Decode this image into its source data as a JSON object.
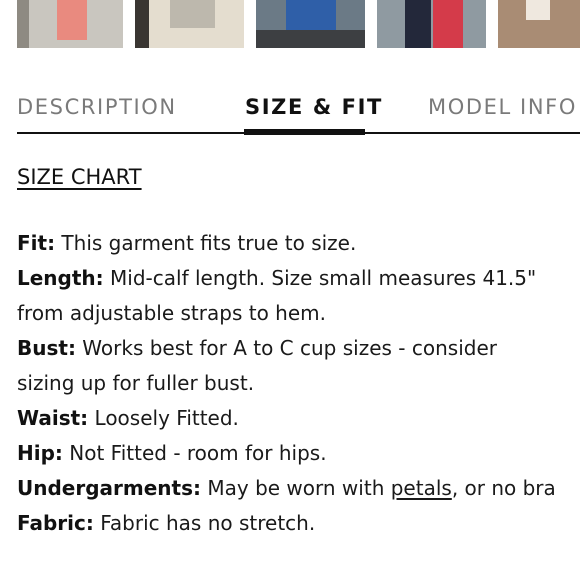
{
  "thumbnails": [
    {
      "name": "thumbnail-1",
      "colors": [
        "#c9c6bf",
        "#e98a7f"
      ]
    },
    {
      "name": "thumbnail-2",
      "colors": [
        "#e4ddcf",
        "#bdb8ad"
      ]
    },
    {
      "name": "thumbnail-3",
      "colors": [
        "#6b7a86",
        "#2f5fa8"
      ]
    },
    {
      "name": "thumbnail-4",
      "colors": [
        "#8f9aa1",
        "#d43b4a"
      ]
    },
    {
      "name": "thumbnail-5",
      "colors": [
        "#a98c74",
        "#efe8df"
      ]
    }
  ],
  "tabs": {
    "description": "DESCRIPTION",
    "size_fit": "SIZE & FIT",
    "model_info": "MODEL INFO",
    "active": "size_fit"
  },
  "size_chart_link": "SIZE CHART",
  "details": {
    "fit_label": "Fit:",
    "fit_text": " This garment fits true to size.",
    "length_label": "Length:",
    "length_text_1": " Mid-calf length. Size small measures 41.5\"",
    "length_text_2": "from adjustable straps to hem.",
    "bust_label": "Bust:",
    "bust_text_1": " Works best for A to C cup sizes - consider",
    "bust_text_2": "sizing up for fuller bust.",
    "waist_label": "Waist:",
    "waist_text": " Loosely Fitted.",
    "hip_label": "Hip:",
    "hip_text": " Not Fitted - room for hips.",
    "undergarments_label": "Undergarments:",
    "undergarments_text_1": " May be worn with ",
    "undergarments_link": "petals",
    "undergarments_text_2": ", or no bra",
    "fabric_label": "Fabric:",
    "fabric_text": " Fabric has no stretch."
  }
}
